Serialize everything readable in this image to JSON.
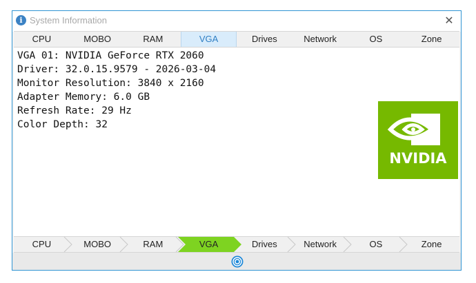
{
  "window": {
    "title": "System Information",
    "close_glyph": "✕"
  },
  "tabs": [
    "CPU",
    "MOBO",
    "RAM",
    "VGA",
    "Drives",
    "Network",
    "OS",
    "Zone"
  ],
  "active_tab": "VGA",
  "info": {
    "vga": "VGA 01: NVIDIA GeForce RTX 2060",
    "driver": "Driver: 32.0.15.9579 - 2026-03-04",
    "resolution": "Monitor Resolution: 3840 x 2160",
    "memory": "Adapter Memory: 6.0 GB",
    "refresh": "Refresh Rate: 29 Hz",
    "depth": "Color Depth: 32"
  },
  "logo": {
    "word": "NVIDIA",
    "color": "#76b900",
    "icon": "nvidia-eye-icon"
  },
  "bottom_nav": [
    "CPU",
    "MOBO",
    "RAM",
    "VGA",
    "Drives",
    "Network",
    "OS",
    "Zone"
  ],
  "status_icon": "refresh-icon",
  "colors": {
    "accent": "#2f94d3",
    "active_step": "#7ed321",
    "title_text": "#a9a9a9"
  }
}
